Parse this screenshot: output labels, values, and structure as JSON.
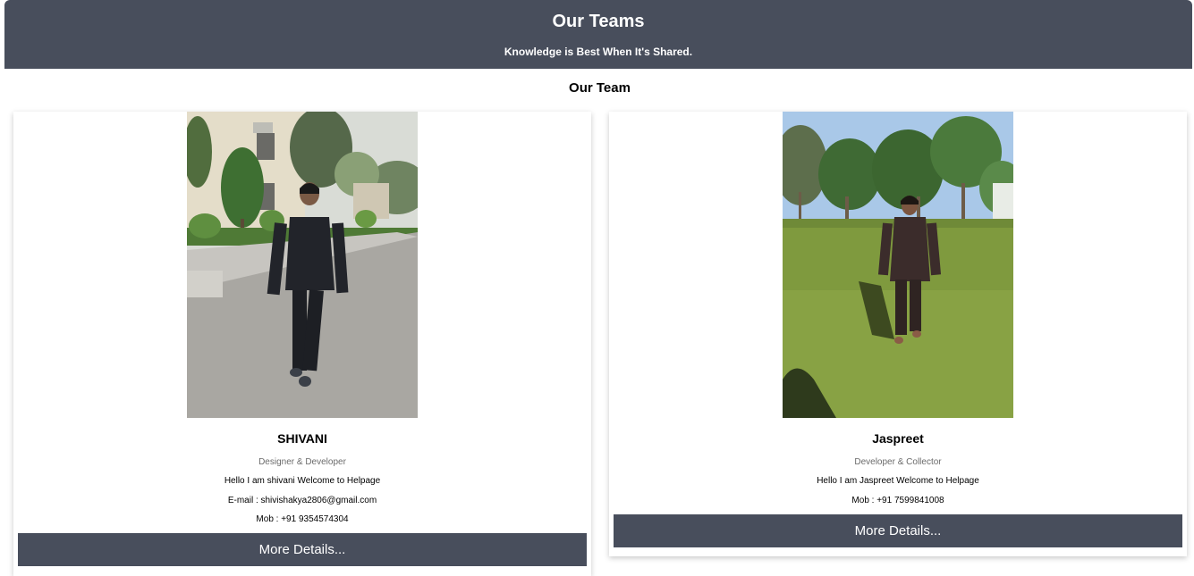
{
  "header": {
    "title": "Our Teams",
    "tagline": "Knowledge is Best When It's Shared."
  },
  "section": {
    "title": "Our Team"
  },
  "members": [
    {
      "name": "SHIVANI",
      "role": "Designer & Developer",
      "intro": "Hello I am shivani Welcome to Helpage",
      "email": "E-mail : shivishakya2806@gmail.com",
      "mobile": "Mob : +91 9354574304",
      "button_label": "More Details..."
    },
    {
      "name": "Jaspreet",
      "role": "Developer & Collector",
      "intro": "Hello I am Jaspreet Welcome to Helpage",
      "mobile": "Mob : +91 7599841008",
      "button_label": "More Details..."
    }
  ],
  "colors": {
    "header_bg": "#484e5c",
    "button_bg": "#484e5c",
    "role_text": "#6b6b6b"
  }
}
